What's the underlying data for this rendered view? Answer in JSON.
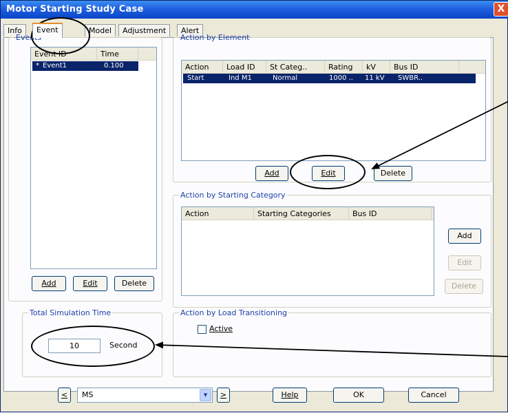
{
  "window": {
    "title": "Motor Starting Study Case",
    "close_glyph": "X"
  },
  "tabs": [
    "Info",
    "Event",
    "Model",
    "Adjustment",
    "Alert"
  ],
  "events": {
    "legend": "Events",
    "columns": [
      "Event ID",
      "Time"
    ],
    "rows": [
      {
        "marker": "*",
        "id": "Event1",
        "time": "0.100"
      }
    ],
    "buttons": {
      "add": "Add",
      "edit": "Edit",
      "delete": "Delete"
    }
  },
  "action_by_element": {
    "legend": "Action by Element",
    "columns": [
      "Action",
      "Load ID",
      "St Categ..",
      "Rating",
      "kV",
      "Bus ID"
    ],
    "rows": [
      {
        "action": "Start",
        "load_id": "Ind M1",
        "st_categ": "Normal",
        "rating": "1000 ..",
        "kv": "11 kV",
        "bus_id": "SWBR.."
      }
    ],
    "buttons": {
      "add": "Add",
      "edit": "Edit",
      "delete": "Delete"
    }
  },
  "action_by_starting_category": {
    "legend": "Action by Starting Category",
    "columns": [
      "Action",
      "Starting Categories",
      "Bus ID"
    ],
    "buttons": {
      "add": "Add",
      "edit": "Edit",
      "delete": "Delete"
    }
  },
  "total_simulation_time": {
    "legend": "Total Simulation Time",
    "value": "10",
    "unit": "Second"
  },
  "action_by_load_transitioning": {
    "legend": "Action by Load Transitioning",
    "active_label": "Active",
    "active_checked": false
  },
  "footer": {
    "prev_glyph": "<",
    "next_glyph": ">",
    "study_case": "MS",
    "dropdown_glyph": "▾",
    "help": "Help",
    "ok": "OK",
    "cancel": "Cancel"
  },
  "colors": {
    "title_bar": "#1f5fe0",
    "selection": "#0a246a",
    "group_title": "#1c3fa8",
    "dialog_face": "#ece9d8"
  }
}
